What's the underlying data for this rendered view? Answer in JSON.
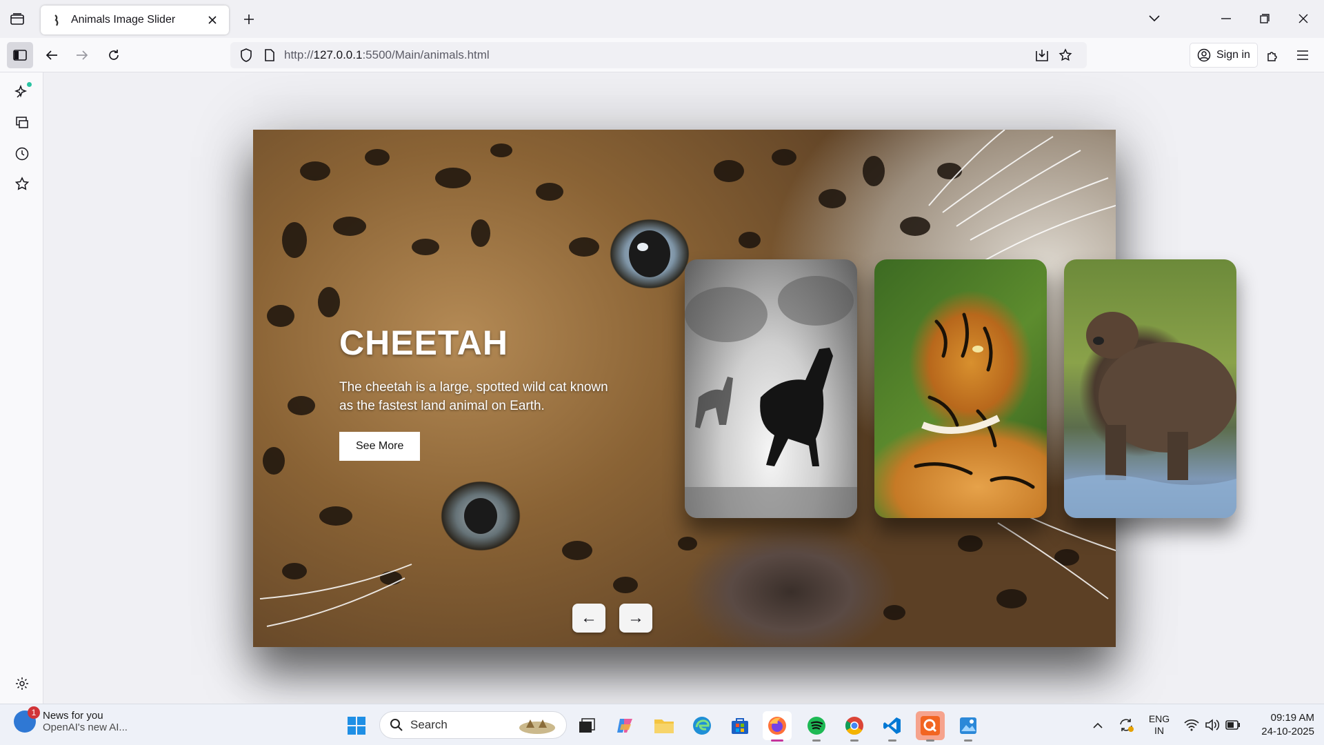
{
  "browser": {
    "tab_title": "Animals Image Slider",
    "url_prefix": "http://",
    "url_host": "127.0.0.1",
    "url_rest": ":5500/Main/animals.html",
    "sign_in_label": "Sign in"
  },
  "slider": {
    "title": "CHEETAH",
    "description": "The cheetah is a large, spotted wild cat known as the fastest land animal on Earth.",
    "see_more_label": "See More",
    "thumbnails": [
      "horse",
      "tiger",
      "bear"
    ],
    "prev_arrow": "←",
    "next_arrow": "→"
  },
  "taskbar": {
    "news_badge": "1",
    "news_title": "News for you",
    "news_subtitle": "OpenAI's new AI...",
    "search_label": "Search",
    "language_line1": "ENG",
    "language_line2": "IN",
    "time": "09:19 AM",
    "date": "24-10-2025"
  },
  "colors": {
    "accent_dot": "#2ac3a2",
    "browser_chrome": "#f0f0f4",
    "taskbar": "#eef1f8"
  }
}
